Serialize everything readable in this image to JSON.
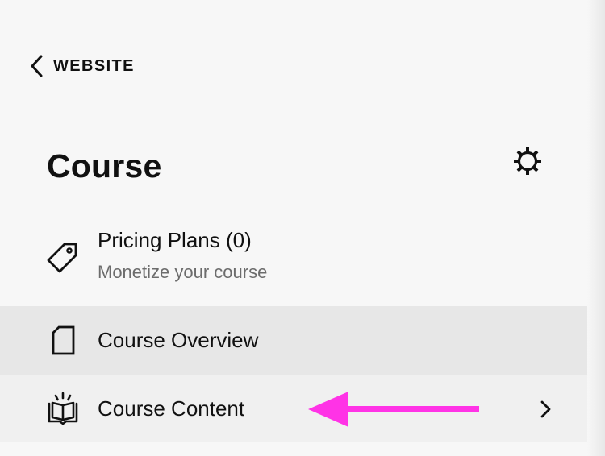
{
  "nav": {
    "back_label": "WEBSITE",
    "back_icon": "chevron-left-icon"
  },
  "header": {
    "title": "Course",
    "settings_icon": "gear-icon"
  },
  "menu": {
    "items": [
      {
        "title": "Pricing Plans (0)",
        "subtitle": "Monetize your course",
        "icon": "tag-icon"
      },
      {
        "title": "Course Overview",
        "icon": "document-icon",
        "state": "hovered"
      },
      {
        "title": "Course Content",
        "icon": "open-book-icon",
        "trailing_icon": "chevron-right-icon"
      }
    ]
  },
  "annotation": {
    "icon": "arrow-left-icon",
    "color": "#ff33e6"
  },
  "colors": {
    "background": "#f7f7f7",
    "hover_row": "#e7e7e7",
    "row": "#f0f0f0",
    "text_primary": "#111111",
    "text_secondary": "#6c6c6c"
  }
}
